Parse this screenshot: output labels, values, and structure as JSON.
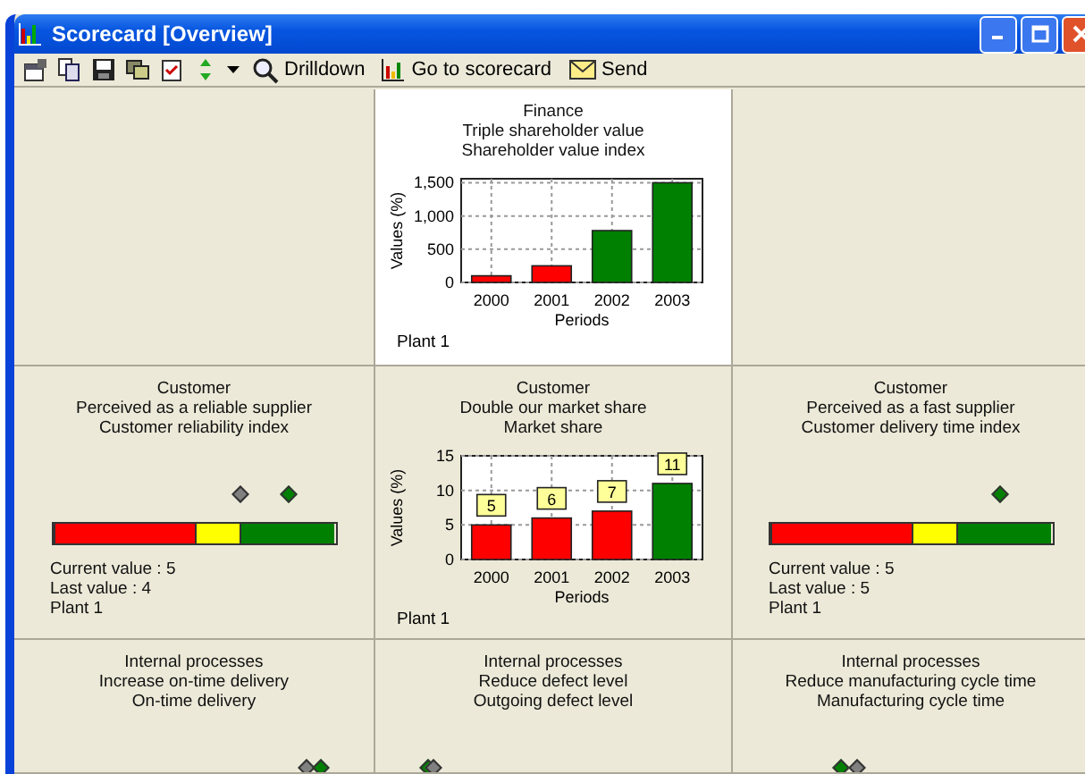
{
  "window": {
    "title": "Scorecard [Overview]"
  },
  "toolbar": [
    {
      "kind": "properties"
    },
    {
      "kind": "copy"
    },
    {
      "kind": "save"
    },
    {
      "kind": "copies"
    },
    {
      "kind": "checklist"
    },
    {
      "kind": "refresh"
    },
    {
      "kind": "dropdown"
    },
    {
      "kind": "drilldown",
      "label": "Drilldown"
    },
    {
      "kind": "scorecard",
      "label": "Go to scorecard"
    },
    {
      "kind": "send",
      "label": "Send"
    }
  ],
  "cells": [
    {
      "kind": "empty",
      "selected": false
    },
    {
      "kind": "chart",
      "selected": true,
      "lines": [
        "Finance",
        "Triple shareholder value",
        "Shareholder value index"
      ],
      "footer": "Plant 1",
      "chart_data": {
        "type": "bar",
        "xlabel": "Periods",
        "ylabel": "Values (%)",
        "categories": [
          "2000",
          "2001",
          "2002",
          "2003"
        ],
        "series": [
          {
            "color": "#ff0000",
            "values": [
              100,
              250,
              null,
              null
            ]
          },
          {
            "color": "#008000",
            "values": [
              null,
              null,
              780,
              1500
            ]
          }
        ],
        "grid": true,
        "ylim": [
          0,
          1560
        ],
        "yticks": [
          {
            "value": 0,
            "label": "0"
          },
          {
            "value": 500,
            "label": "500"
          },
          {
            "value": 1000,
            "label": "1,000"
          },
          {
            "value": 1500,
            "label": "1,500"
          }
        ]
      }
    },
    {
      "kind": "empty",
      "selected": false
    },
    {
      "kind": "gauge",
      "selected": false,
      "lines": [
        "Customer",
        "Perceived as a reliable supplier",
        "Customer reliability index"
      ],
      "markers": [
        {
          "color": "#808080"
        },
        {
          "color": "#008000"
        }
      ],
      "segments": [
        {
          "color": "#ff0000"
        },
        {
          "color": "#ffff00"
        },
        {
          "color": "#008000"
        }
      ],
      "info": [
        "Current value : 5",
        "Last value : 4",
        "Plant 1"
      ]
    },
    {
      "kind": "chart",
      "selected": false,
      "lines": [
        "Customer",
        "Double our market share",
        "Market share"
      ],
      "footer": "Plant 1",
      "chart_data": {
        "type": "bar",
        "xlabel": "Periods",
        "ylabel": "Values (%)",
        "categories": [
          "2000",
          "2001",
          "2002",
          "2003"
        ],
        "series": [
          {
            "color": "#ff0000",
            "values": [
              5,
              6,
              7,
              null
            ]
          },
          {
            "color": "#008000",
            "values": [
              null,
              null,
              null,
              11
            ]
          }
        ],
        "grid": true,
        "data_labels": true,
        "ylim": [
          0,
          15
        ],
        "yticks": [
          0,
          5,
          10,
          15
        ]
      }
    },
    {
      "kind": "gauge",
      "selected": false,
      "lines": [
        "Customer",
        "Perceived as a fast supplier",
        "Customer delivery time index"
      ],
      "markers": [
        {
          "color": "#008000"
        }
      ],
      "segments": [
        {
          "color": "#ff0000"
        },
        {
          "color": "#ffff00"
        },
        {
          "color": "#008000"
        }
      ],
      "info": [
        "Current value : 5",
        "Last value : 5",
        "Plant 1"
      ]
    },
    {
      "kind": "gauge",
      "selected": false,
      "lines": [
        "Internal processes",
        "Increase on-time delivery",
        "On-time delivery"
      ],
      "markers": [
        {
          "color": "#808080"
        },
        {
          "color": "#008000"
        }
      ]
    },
    {
      "kind": "gauge",
      "selected": false,
      "lines": [
        "Internal processes",
        "Reduce defect level",
        "Outgoing defect level"
      ],
      "markers": [
        {
          "color": "#008000"
        },
        {
          "color": "#808080"
        }
      ]
    },
    {
      "kind": "gauge",
      "selected": false,
      "lines": [
        "Internal processes",
        "Reduce manufacturing cycle time",
        "Manufacturing cycle time"
      ],
      "markers": [
        {
          "color": "#008000"
        },
        {
          "color": "#808080"
        }
      ]
    }
  ]
}
